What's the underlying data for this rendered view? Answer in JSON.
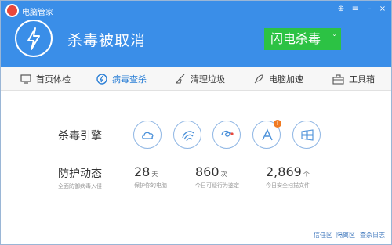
{
  "app": {
    "title": "电脑管家"
  },
  "window_controls": {
    "shield": "⊕",
    "settings": "≡",
    "minimize": "–",
    "close": "×"
  },
  "hero": {
    "title": "杀毒被取消",
    "button": "闪电杀毒",
    "chevron": "ˇ"
  },
  "nav": {
    "items": [
      {
        "label": "首页体检",
        "icon": "monitor-icon"
      },
      {
        "label": "病毒查杀",
        "icon": "virus-scan-icon",
        "active": true
      },
      {
        "label": "清理垃圾",
        "icon": "broom-icon"
      },
      {
        "label": "电脑加速",
        "icon": "rocket-icon"
      },
      {
        "label": "工具箱",
        "icon": "toolbox-icon"
      }
    ]
  },
  "antivirus": {
    "label": "杀毒引擎",
    "engines": [
      "cloud-engine-icon",
      "system-repair-engine-icon",
      "behavior-engine-icon",
      "avira-engine-icon",
      "windows-engine-icon"
    ],
    "badge": "!"
  },
  "protection": {
    "label": "防护动态",
    "sublabel": "全面防御病毒入侵",
    "stats": [
      {
        "value": "28",
        "unit": "天",
        "desc": "保护你的电脑"
      },
      {
        "value": "860",
        "unit": "次",
        "desc": "今日可疑行为鉴定"
      },
      {
        "value": "2,869",
        "unit": "个",
        "desc": "今日安全扫描文件"
      }
    ]
  },
  "footer": {
    "links": [
      "信任区",
      "隔离区",
      "查杀日志"
    ]
  },
  "colors": {
    "header": "#3a8ee8",
    "flash_button": "#2cc244",
    "active_nav": "#2b7fd6"
  }
}
